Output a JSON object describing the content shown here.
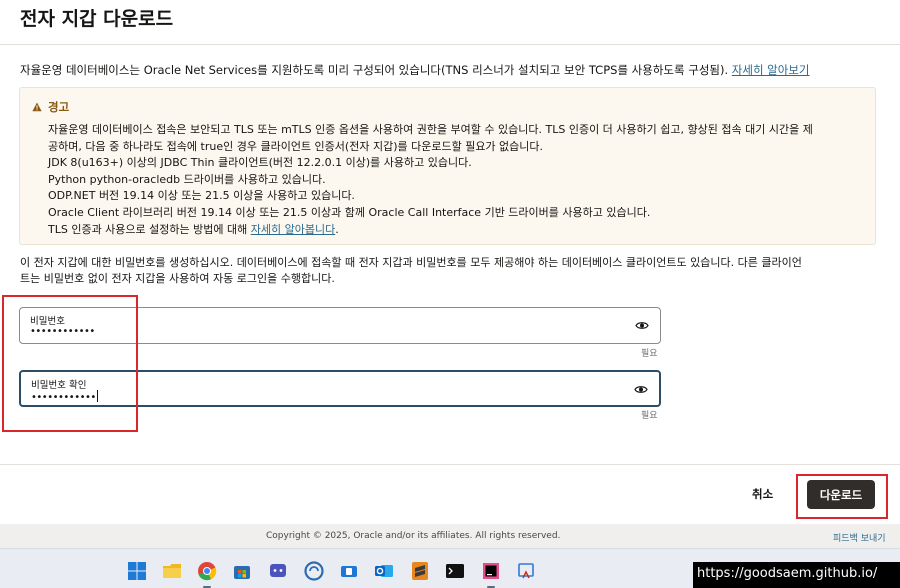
{
  "dialog": {
    "title": "전자 지갑 다운로드",
    "intro_text": "자율운영 데이터베이스는 Oracle Net Services를 지원하도록 미리 구성되어 있습니다(TNS 리스너가 설치되고 보안 TCPS를 사용하도록 구성됨). ",
    "intro_link": "자세히 알아보기"
  },
  "warning": {
    "title": "경고",
    "lines": [
      "자율운영 데이터베이스 접속은 보안되고 TLS 또는 mTLS 인증 옵션을 사용하여 권한을 부여할 수 있습니다. TLS 인증이 더 사용하기 쉽고, 향상된 접속 대기 시간을 제",
      "공하며, 다음 중 하나라도 접속에 true인 경우 클라이언트 인증서(전자 지갑)를 다운로드할 필요가 없습니다.",
      "JDK 8(u163+) 이상의 JDBC Thin 클라이언트(버전 12.2.0.1 이상)를 사용하고 있습니다.",
      "Python python-oracledb 드라이버를 사용하고 있습니다.",
      "ODP.NET 버전 19.14 이상 또는 21.5 이상을 사용하고 있습니다.",
      "Oracle Client 라이브러리 버전 19.14 이상 또는 21.5 이상과 함께 Oracle Call Interface 기반 드라이버를 사용하고 있습니다."
    ],
    "last_line_text": "TLS 인증과 사용으로 설정하는 방법에 대해 ",
    "last_line_link": "자세히 알아봅니다",
    "last_line_suffix": "."
  },
  "instructions": {
    "line1": "이 전자 지갑에 대한 비밀번호를 생성하십시오. 데이터베이스에 접속할 때 전자 지갑과 비밀번호를 모두 제공해야 하는 데이터베이스 클라이언트도 있습니다. 다른 클라이언",
    "line2": "트는 비밀번호 없이 전자 지갑을 사용하여 자동 로그인을 수행합니다."
  },
  "password": {
    "label": "비밀번호",
    "value": "••••••••••••",
    "required": "필요"
  },
  "confirm_password": {
    "label": "비밀번호 확인",
    "value": "••••••••••••",
    "required": "필요"
  },
  "footer": {
    "cancel_label": "취소",
    "download_label": "다운로드"
  },
  "page_footer": {
    "copyright": "Copyright © 2025, Oracle and/or its affiliates. All rights reserved.",
    "feedback": "피드백 보내기"
  },
  "watermark": "https://goodsaem.github.io/",
  "colors": {
    "primary_button": "#312d2a",
    "link": "#2b6a8f",
    "warning_bg": "#fcf8ef",
    "warning_title": "#8a5a14",
    "annotation": "#d9272e",
    "focus_border": "#2d4d66"
  },
  "taskbar": {
    "icons": [
      "windows-start-icon",
      "file-explorer-icon",
      "chrome-icon",
      "store-icon",
      "teams-chat-icon",
      "edge-sync-icon",
      "phone-link-icon",
      "outlook-icon",
      "sublime-text-icon",
      "terminal-icon",
      "intellij-icon",
      "snipping-tool-icon"
    ]
  }
}
